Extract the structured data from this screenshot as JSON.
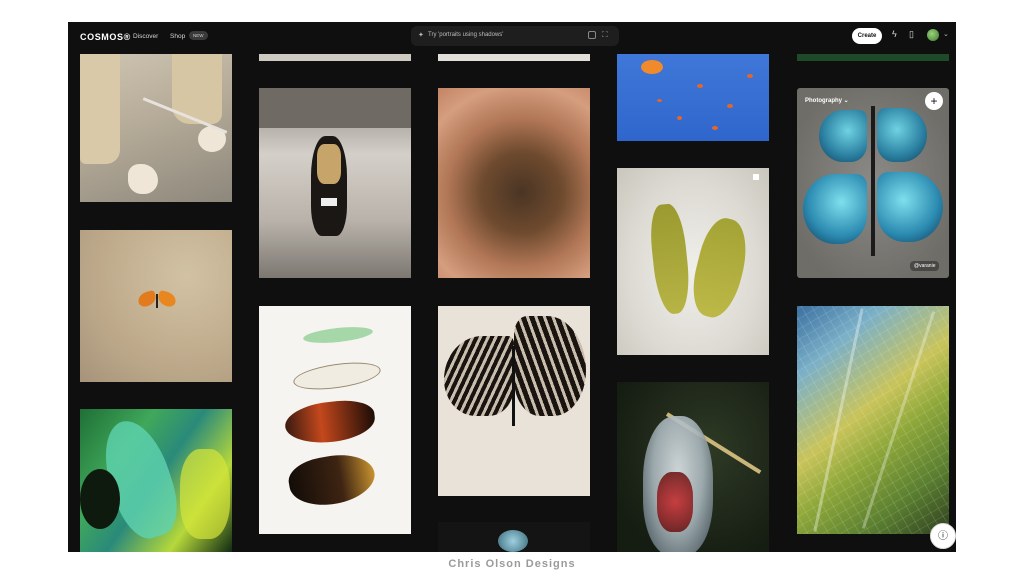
{
  "header": {
    "logo": "COSMOS®",
    "nav": {
      "discover": "Discover",
      "shop": "Shop",
      "shop_badge": "NEW"
    },
    "search": {
      "placeholder": "Try 'portraits using shadows'"
    },
    "create_label": "Create"
  },
  "feature_tile": {
    "category": "Photography ⌄",
    "credit": "@varanie",
    "add_label": "+"
  },
  "watermark": "Chris Olson Designs",
  "icons": {
    "search": "sparkle-icon",
    "image_search": "image-icon",
    "expand": "expand-icon",
    "bolt": "bolt-icon",
    "bookmark": "bookmark-icon",
    "info": "info-icon"
  },
  "colors": {
    "background": "#0f0f0f",
    "frame": "#ffffff",
    "accent": "#ffffff"
  }
}
